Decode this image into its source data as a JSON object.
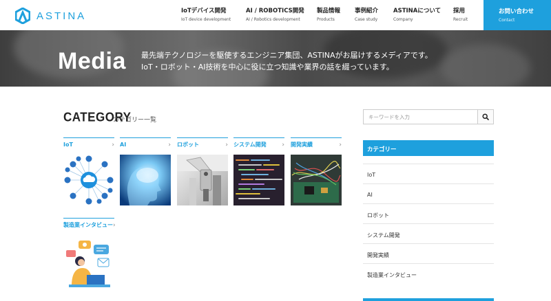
{
  "brand": {
    "name": "ASTINA",
    "color": "#1ea0dd"
  },
  "nav": {
    "items": [
      {
        "jp": "IoTデバイス開発",
        "en": "IoT device development"
      },
      {
        "jp": "AI / ROBOTICS開発",
        "en": "AI / Robotics development"
      },
      {
        "jp": "製品情報",
        "en": "Products"
      },
      {
        "jp": "事例紹介",
        "en": "Case study"
      },
      {
        "jp": "ASTINAについて",
        "en": "Company"
      },
      {
        "jp": "採用",
        "en": "Recruit"
      }
    ],
    "contact": {
      "jp": "お問い合わせ",
      "en": "Contact"
    }
  },
  "hero": {
    "title": "Media",
    "line1": "最先端テクノロジーを駆使するエンジニア集団、ASTINAがお届けするメディアです。",
    "line2": "IoT・ロボット・AI技術を中心に役に立つ知識や業界の話を綴っています。"
  },
  "category": {
    "title": "CATEGORY",
    "subtitle": "カテゴリー一覧",
    "cards": [
      {
        "label": "IoT"
      },
      {
        "label": "AI"
      },
      {
        "label": "ロボット"
      },
      {
        "label": "システム開発"
      },
      {
        "label": "開発実績"
      },
      {
        "label": "製造業インタビュー"
      }
    ]
  },
  "sidebar": {
    "search_placeholder": "キーワードを入力",
    "category_heading": "カテゴリー",
    "items": [
      {
        "label": "IoT"
      },
      {
        "label": "AI"
      },
      {
        "label": "ロボット"
      },
      {
        "label": "システム開発"
      },
      {
        "label": "開発実績"
      },
      {
        "label": "製造業インタビュー"
      }
    ]
  }
}
